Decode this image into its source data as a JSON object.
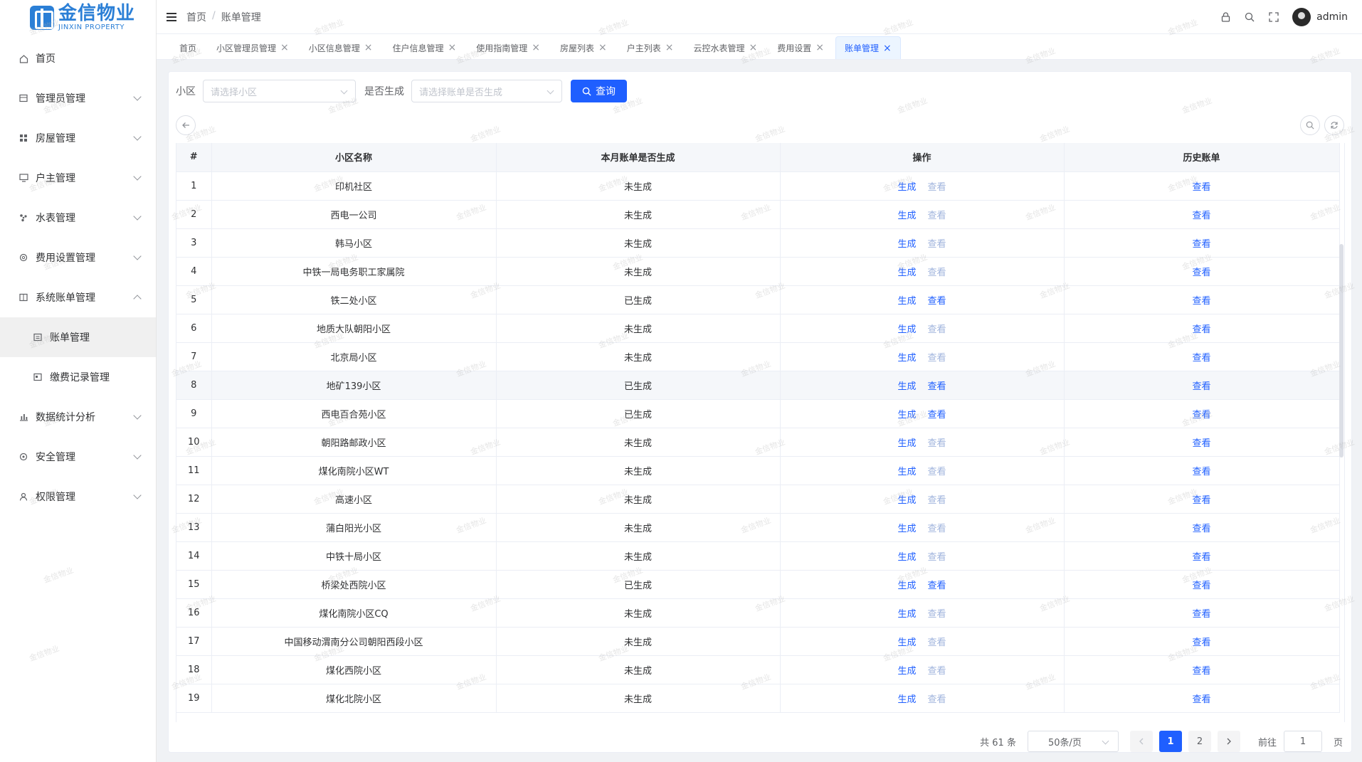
{
  "brand": {
    "name_cn": "金信物业",
    "name_en": "JINXIN PROPERTY"
  },
  "sidebar": {
    "items": [
      {
        "label": "首页",
        "icon": "home-icon",
        "expandable": false
      },
      {
        "label": "管理员管理",
        "icon": "admin-icon",
        "expandable": true
      },
      {
        "label": "房屋管理",
        "icon": "grid-icon",
        "expandable": true
      },
      {
        "label": "户主管理",
        "icon": "monitor-icon",
        "expandable": true
      },
      {
        "label": "水表管理",
        "icon": "fan-icon",
        "expandable": true
      },
      {
        "label": "费用设置管理",
        "icon": "settings-icon",
        "expandable": true
      },
      {
        "label": "系统账单管理",
        "icon": "book-icon",
        "expandable": true,
        "expanded": true
      },
      {
        "label": "账单管理",
        "icon": "bill-icon",
        "sub": true,
        "active": true
      },
      {
        "label": "缴费记录管理",
        "icon": "record-icon",
        "sub": true
      },
      {
        "label": "数据统计分析",
        "icon": "chart-icon",
        "expandable": true
      },
      {
        "label": "安全管理",
        "icon": "shield-icon",
        "expandable": true
      },
      {
        "label": "权限管理",
        "icon": "user-icon",
        "expandable": true
      }
    ]
  },
  "header": {
    "breadcrumb": [
      "首页",
      "账单管理"
    ],
    "breadcrumb_sep": "/",
    "username": "admin"
  },
  "tabs": [
    {
      "label": "首页",
      "closable": false
    },
    {
      "label": "小区管理员管理",
      "closable": true
    },
    {
      "label": "小区信息管理",
      "closable": true
    },
    {
      "label": "住户信息管理",
      "closable": true
    },
    {
      "label": "使用指南管理",
      "closable": true
    },
    {
      "label": "房屋列表",
      "closable": true
    },
    {
      "label": "户主列表",
      "closable": true
    },
    {
      "label": "云控水表管理",
      "closable": true
    },
    {
      "label": "费用设置",
      "closable": true
    },
    {
      "label": "账单管理",
      "closable": true,
      "active": true
    }
  ],
  "filter": {
    "community_label": "小区",
    "community_placeholder": "请选择小区",
    "generated_label": "是否生成",
    "generated_placeholder": "请选择账单是否生成",
    "query_button": "查询"
  },
  "table": {
    "columns": [
      "#",
      "小区名称",
      "本月账单是否生成",
      "操作",
      "历史账单"
    ],
    "action_generate": "生成",
    "action_view": "查看",
    "history_view": "查看",
    "rows": [
      {
        "no": "1",
        "name": "印机社区",
        "status": "未生成"
      },
      {
        "no": "2",
        "name": "西电一公司",
        "status": "未生成"
      },
      {
        "no": "3",
        "name": "韩马小区",
        "status": "未生成"
      },
      {
        "no": "4",
        "name": "中铁一局电务职工家属院",
        "status": "未生成"
      },
      {
        "no": "5",
        "name": "铁二处小区",
        "status": "已生成"
      },
      {
        "no": "6",
        "name": "地质大队朝阳小区",
        "status": "未生成"
      },
      {
        "no": "7",
        "name": "北京局小区",
        "status": "未生成"
      },
      {
        "no": "8",
        "name": "地矿139小区",
        "status": "已生成",
        "highlight": true
      },
      {
        "no": "9",
        "name": "西电百合苑小区",
        "status": "已生成"
      },
      {
        "no": "10",
        "name": "朝阳路邮政小区",
        "status": "未生成"
      },
      {
        "no": "11",
        "name": "煤化南院小区WT",
        "status": "未生成"
      },
      {
        "no": "12",
        "name": "高速小区",
        "status": "未生成"
      },
      {
        "no": "13",
        "name": "蒲白阳光小区",
        "status": "未生成"
      },
      {
        "no": "14",
        "name": "中铁十局小区",
        "status": "未生成"
      },
      {
        "no": "15",
        "name": "桥梁处西院小区",
        "status": "已生成"
      },
      {
        "no": "16",
        "name": "煤化南院小区CQ",
        "status": "未生成"
      },
      {
        "no": "17",
        "name": "中国移动渭南分公司朝阳西段小区",
        "status": "未生成"
      },
      {
        "no": "18",
        "name": "煤化西院小区",
        "status": "未生成"
      },
      {
        "no": "19",
        "name": "煤化北院小区",
        "status": "未生成"
      }
    ]
  },
  "pagination": {
    "total_text": "共 61 条",
    "page_size": "50条/页",
    "pages": [
      "1",
      "2"
    ],
    "current": "1",
    "goto_label": "前往",
    "goto_value": "1",
    "page_suffix": "页"
  },
  "watermark_text": "金信物业",
  "colors": {
    "primary": "#1f5fff",
    "brand": "#2b7fd6",
    "disabled_link": "#a0b4dd"
  }
}
